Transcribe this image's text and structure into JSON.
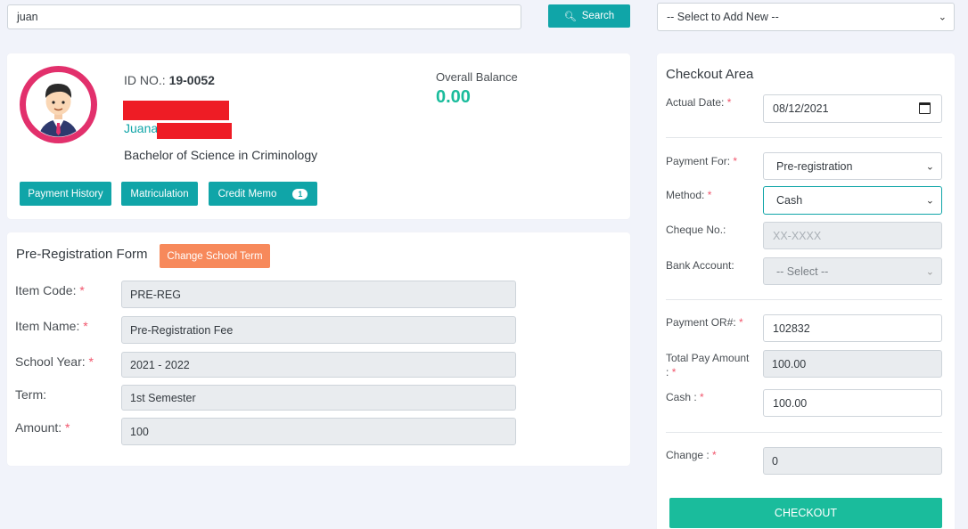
{
  "top": {
    "search_value": "juan",
    "search_button": "Search",
    "add_new_select": "-- Select to Add New --"
  },
  "student": {
    "id_label": "ID NO.:",
    "id_value": "19-0052",
    "first_name": "Juana",
    "course": "Bachelor of Science in Criminology",
    "balance_label": "Overall Balance",
    "balance_value": "0.00",
    "buttons": {
      "payment_history": "Payment History",
      "matriculation": "Matriculation",
      "credit_memo": "Credit Memo",
      "credit_memo_count": "1"
    }
  },
  "form": {
    "title": "Pre-Registration Form",
    "change_term_button": "Change School Term",
    "fields": [
      {
        "label": "Item Code:",
        "required": "*",
        "value": "PRE-REG"
      },
      {
        "label": "Item Name:",
        "required": "*",
        "value": "Pre-Registration Fee"
      },
      {
        "label": "School Year:",
        "required": "*",
        "value": "2021 - 2022"
      },
      {
        "label": "Term:",
        "required": "",
        "value": "1st Semester"
      },
      {
        "label": "Amount:",
        "required": "*",
        "value": "100"
      }
    ]
  },
  "checkout": {
    "title": "Checkout Area",
    "actual_date_label": "Actual Date:",
    "actual_date_value": "08/12/2021",
    "payment_for_label": "Payment For:",
    "payment_for_value": "Pre-registration",
    "method_label": "Method:",
    "method_value": "Cash",
    "cheque_label": "Cheque No.:",
    "cheque_placeholder": "XX-XXXX",
    "bank_label": "Bank Account:",
    "bank_value": "-- Select --",
    "or_label": "Payment OR#:",
    "or_value": "102832",
    "total_label_1": "Total Pay Amount",
    "total_label_2": ":",
    "total_value": "100.00",
    "cash_label": "Cash :",
    "cash_value": "100.00",
    "change_label": "Change :",
    "change_value": "0",
    "required_mark": "*",
    "checkout_button": "CHECKOUT"
  },
  "colors": {
    "teal": "#10a5a8",
    "green": "#1abc9c",
    "orange": "#f7895b",
    "red_required": "#f1556c",
    "avatar_ring": "#e2306c"
  }
}
